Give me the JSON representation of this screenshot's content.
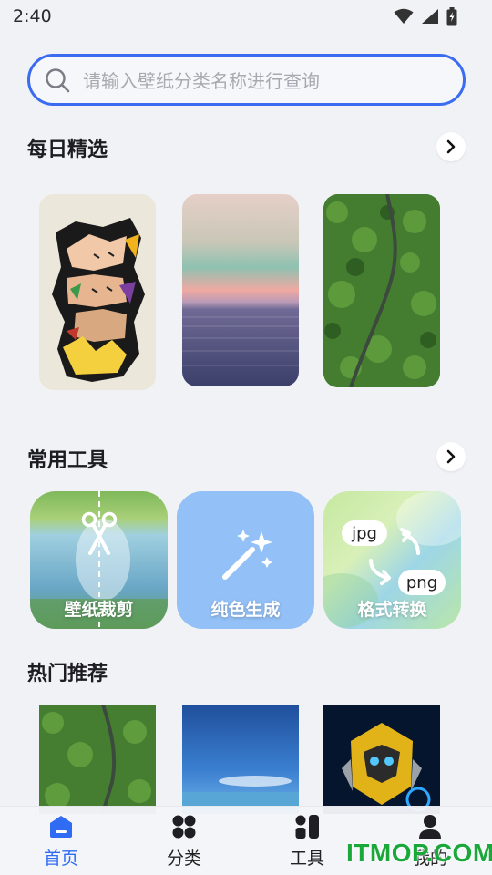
{
  "status_bar": {
    "time": "2:40"
  },
  "search": {
    "placeholder": "请输入壁纸分类名称进行查询"
  },
  "daily": {
    "title": "每日精选"
  },
  "tools": {
    "title": "常用工具",
    "items": [
      {
        "label": "壁纸裁剪"
      },
      {
        "label": "纯色生成"
      },
      {
        "label": "格式转换",
        "format_from": "jpg",
        "format_to": "png"
      }
    ]
  },
  "hot": {
    "title": "热门推荐"
  },
  "nav": {
    "items": [
      {
        "label": "首页",
        "active": true
      },
      {
        "label": "分类"
      },
      {
        "label": "工具"
      },
      {
        "label": "我的"
      }
    ]
  },
  "watermark": "ITMOP.COM",
  "colors": {
    "accent": "#2f6bf3",
    "search_border": "#3a6cf0",
    "background": "#f1f2f6"
  }
}
